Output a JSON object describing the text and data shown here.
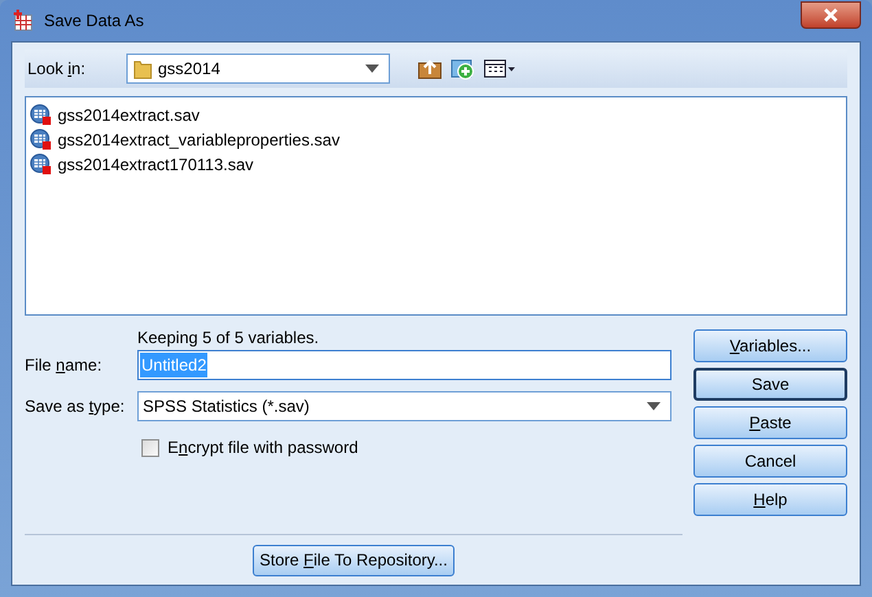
{
  "window": {
    "title": "Save Data As"
  },
  "look_in": {
    "label": {
      "before": "Look ",
      "key": "i",
      "after": "n:"
    },
    "value": "gss2014"
  },
  "files": [
    {
      "name": "gss2014extract.sav",
      "selected": false
    },
    {
      "name": "gss2014extract_variableproperties.sav",
      "selected": false
    },
    {
      "name": "gss2014extract170113.sav",
      "selected": false
    }
  ],
  "keeping_note": "Keeping 5 of 5 variables.",
  "file_name": {
    "label": {
      "before": "File ",
      "key": "n",
      "after": "ame:"
    },
    "value": "Untitled2",
    "value_selected": true
  },
  "save_as_type": {
    "label": {
      "before": "Save as ",
      "key": "t",
      "after": "ype:"
    },
    "value": "SPSS Statistics (*.sav)"
  },
  "encrypt": {
    "label": {
      "before": "E",
      "key": "n",
      "after": "crypt file with password"
    },
    "checked": false
  },
  "buttons": [
    {
      "label": {
        "key": "V",
        "after": "ariables..."
      },
      "default": false
    },
    {
      "label": {
        "before": "Save"
      },
      "default": true
    },
    {
      "label": {
        "key": "P",
        "after": "aste"
      },
      "default": false
    },
    {
      "label": {
        "before": "Cancel"
      },
      "default": false
    },
    {
      "label": {
        "key": "H",
        "after": "elp"
      },
      "default": false
    }
  ],
  "repository_button": {
    "label": {
      "before": "Store ",
      "key": "F",
      "after": "ile To Repository..."
    }
  }
}
